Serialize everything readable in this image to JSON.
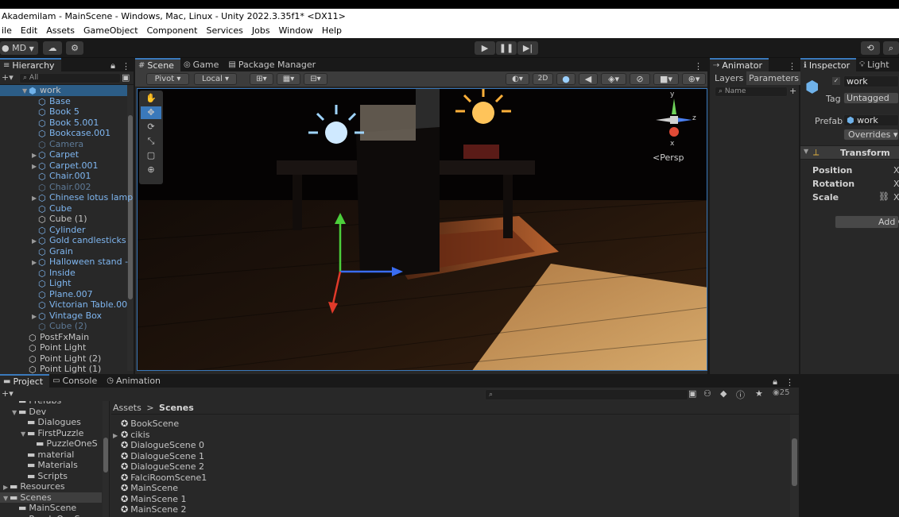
{
  "window": {
    "title": "Akademilam - MainScene - Windows, Mac, Linux - Unity 2022.3.35f1* <DX11>"
  },
  "menu": [
    "ile",
    "Edit",
    "Assets",
    "GameObject",
    "Component",
    "Services",
    "Jobs",
    "Window",
    "Help"
  ],
  "toolbar": {
    "account": "MD",
    "play_icon": "play-icon",
    "pause_icon": "pause-icon",
    "step_icon": "step-icon"
  },
  "hierarchy": {
    "tab": "Hierarchy",
    "search_placeholder": "All",
    "root": "work",
    "items": [
      {
        "label": "Base",
        "style": "blue",
        "arrow": false,
        "indent": 2
      },
      {
        "label": "Book 5",
        "style": "blue",
        "arrow": false,
        "indent": 2
      },
      {
        "label": "Book 5.001",
        "style": "blue",
        "arrow": false,
        "indent": 2
      },
      {
        "label": "Bookcase.001",
        "style": "blue",
        "arrow": false,
        "indent": 2
      },
      {
        "label": "Camera",
        "style": "dim",
        "arrow": false,
        "indent": 2
      },
      {
        "label": "Carpet",
        "style": "blue",
        "arrow": true,
        "indent": 2
      },
      {
        "label": "Carpet.001",
        "style": "blue",
        "arrow": true,
        "indent": 2
      },
      {
        "label": "Chair.001",
        "style": "blue",
        "arrow": false,
        "indent": 2
      },
      {
        "label": "Chair.002",
        "style": "dim",
        "arrow": false,
        "indent": 2
      },
      {
        "label": "Chinese lotus lamp",
        "style": "blue",
        "arrow": true,
        "indent": 2
      },
      {
        "label": "Cube",
        "style": "blue",
        "arrow": false,
        "indent": 2
      },
      {
        "label": "Cube (1)",
        "style": "normal",
        "arrow": false,
        "indent": 2
      },
      {
        "label": "Cylinder",
        "style": "blue",
        "arrow": false,
        "indent": 2
      },
      {
        "label": "Gold candlesticks",
        "style": "blue",
        "arrow": true,
        "indent": 2
      },
      {
        "label": "Grain",
        "style": "blue",
        "arrow": false,
        "indent": 2
      },
      {
        "label": "Halloween stand -",
        "style": "blue",
        "arrow": true,
        "indent": 2
      },
      {
        "label": "Inside",
        "style": "blue",
        "arrow": false,
        "indent": 2
      },
      {
        "label": "Light",
        "style": "blue",
        "arrow": false,
        "indent": 2
      },
      {
        "label": "Plane.007",
        "style": "blue",
        "arrow": false,
        "indent": 2
      },
      {
        "label": "Victorian Table.00",
        "style": "blue",
        "arrow": false,
        "indent": 2
      },
      {
        "label": "Vintage Box",
        "style": "blue",
        "arrow": true,
        "indent": 2
      },
      {
        "label": "Cube (2)",
        "style": "dim",
        "arrow": false,
        "indent": 2
      },
      {
        "label": "PostFxMain",
        "style": "normal",
        "arrow": false,
        "indent": 1
      },
      {
        "label": "Point Light",
        "style": "normal",
        "arrow": false,
        "indent": 1
      },
      {
        "label": "Point Light (2)",
        "style": "normal",
        "arrow": false,
        "indent": 1
      },
      {
        "label": "Point Light (1)",
        "style": "normal",
        "arrow": false,
        "indent": 1
      }
    ]
  },
  "scene": {
    "tabs": [
      "Scene",
      "Game",
      "Package Manager"
    ],
    "pivot": "Pivot",
    "local": "Local",
    "mode_2d": "2D",
    "persp": "<Persp",
    "gizmo_axes": [
      "y",
      "z",
      "x"
    ]
  },
  "animator": {
    "tab": "Animator",
    "layers": "Layers",
    "parameters": "Parameters",
    "search_placeholder": "Name"
  },
  "inspector": {
    "tab": "Inspector",
    "tab2": "Light",
    "object_name": "work",
    "tag_label": "Tag",
    "tag_value": "Untagged",
    "prefab_label": "Prefab",
    "prefab_value": "work",
    "overrides": "Overrides",
    "component": "Transform",
    "fields": [
      "Position",
      "Rotation",
      "Scale"
    ],
    "axis": "X",
    "add_component": "Add C"
  },
  "project": {
    "tabs": [
      "Project",
      "Console",
      "Animation"
    ],
    "count": "25",
    "tree": [
      {
        "label": "Prefabs",
        "indent": 2,
        "arrow": "",
        "selected": false
      },
      {
        "label": "Dev",
        "indent": 2,
        "arrow": "down",
        "selected": false
      },
      {
        "label": "Dialogues",
        "indent": 3,
        "arrow": "",
        "selected": false
      },
      {
        "label": "FirstPuzzle",
        "indent": 3,
        "arrow": "down",
        "selected": false
      },
      {
        "label": "PuzzleOneS",
        "indent": 4,
        "arrow": "",
        "selected": false
      },
      {
        "label": "material",
        "indent": 3,
        "arrow": "",
        "selected": false
      },
      {
        "label": "Materials",
        "indent": 3,
        "arrow": "",
        "selected": false
      },
      {
        "label": "Scripts",
        "indent": 3,
        "arrow": "",
        "selected": false
      },
      {
        "label": "Resources",
        "indent": 1,
        "arrow": "right",
        "selected": false
      },
      {
        "label": "Scenes",
        "indent": 1,
        "arrow": "down",
        "selected": true
      },
      {
        "label": "MainScene",
        "indent": 2,
        "arrow": "",
        "selected": false
      },
      {
        "label": "PuzzleOneScene",
        "indent": 2,
        "arrow": "",
        "selected": false
      }
    ],
    "breadcrumb": [
      "Assets",
      "Scenes"
    ],
    "files": [
      {
        "label": "BookScene",
        "arrow": false
      },
      {
        "label": "cikis",
        "arrow": true
      },
      {
        "label": "DialogueScene 0",
        "arrow": false
      },
      {
        "label": "DialogueScene 1",
        "arrow": false
      },
      {
        "label": "DialogueScene 2",
        "arrow": false
      },
      {
        "label": "FalciRoomScene1",
        "arrow": false
      },
      {
        "label": "MainScene",
        "arrow": false
      },
      {
        "label": "MainScene 1",
        "arrow": false
      },
      {
        "label": "MainScene 2",
        "arrow": false
      }
    ]
  }
}
